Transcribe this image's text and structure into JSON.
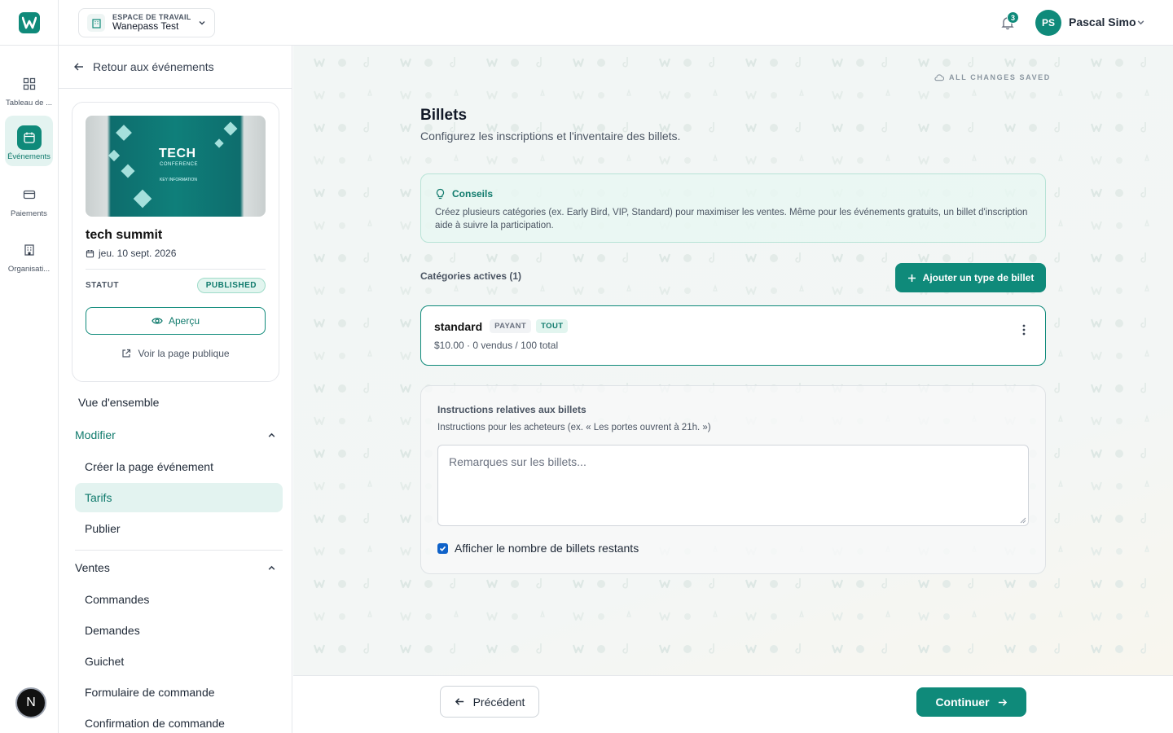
{
  "workspace": {
    "label": "ESPACE DE TRAVAIL",
    "name": "Wanepass Test"
  },
  "notifications": {
    "count": "3"
  },
  "user": {
    "initials": "PS",
    "name": "Pascal Simo"
  },
  "rail": [
    {
      "label": "Tableau de ...",
      "icon": "grid-icon"
    },
    {
      "label": "Événements",
      "icon": "calendar-icon",
      "active": true
    },
    {
      "label": "Paiements",
      "icon": "card-icon"
    },
    {
      "label": "Organisati...",
      "icon": "building-icon"
    }
  ],
  "dev_badge": "N",
  "sidebar": {
    "back": "Retour aux événements",
    "event": {
      "image_title": "TECH",
      "image_subtitle": "CONFERENCE",
      "image_caption": "KEY INFORMATION",
      "title": "tech summit",
      "date": "jeu. 10 sept. 2026",
      "status_label": "STATUT",
      "status": "PUBLISHED",
      "preview": "Aperçu",
      "public_page": "Voir la page publique"
    },
    "overview": "Vue d'ensemble",
    "modify": {
      "title": "Modifier",
      "items": [
        "Créer la page événement",
        "Tarifs",
        "Publier"
      ]
    },
    "sales": {
      "title": "Ventes",
      "items": [
        "Commandes",
        "Demandes",
        "Guichet",
        "Formulaire de commande",
        "Confirmation de commande"
      ]
    }
  },
  "main": {
    "saved": "ALL CHANGES SAVED",
    "title": "Billets",
    "subtitle": "Configurez les inscriptions et l'inventaire des billets.",
    "tips": {
      "title": "Conseils",
      "text": "Créez plusieurs catégories (ex. Early Bird, VIP, Standard) pour maximiser les ventes. Même pour les événements gratuits, un billet d'inscription aide à suivre la participation."
    },
    "categories_label": "Catégories actives (1)",
    "add_ticket": "Ajouter un type de billet",
    "ticket": {
      "name": "standard",
      "tag_paid": "PAYANT",
      "tag_all": "TOUT",
      "meta": "$10.00 · 0 vendus / 100 total"
    },
    "instructions": {
      "title": "Instructions relatives aux billets",
      "help": "Instructions pour les acheteurs (ex. « Les portes ouvrent à 21h. »)",
      "placeholder": "Remarques sur les billets...",
      "show_remaining": "Afficher le nombre de billets restants",
      "show_remaining_checked": true
    }
  },
  "footer": {
    "previous": "Précédent",
    "continue": "Continuer"
  },
  "colors": {
    "accent": "#0f8a7a",
    "accent_light": "#e3f3f0",
    "checkbox": "#0f62c9"
  }
}
